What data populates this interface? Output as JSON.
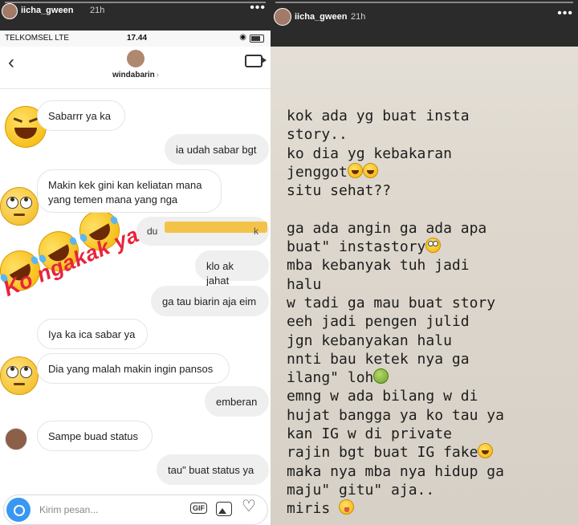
{
  "left_story": {
    "username": "iicha_gween",
    "time": "21h",
    "more": "•••"
  },
  "right_story": {
    "username": "iicha_gween",
    "time": "21h",
    "more": "•••"
  },
  "phone": {
    "carrier": "TELKOMSEL  LTE",
    "clock": "17.44",
    "loc_icon": "◉",
    "back_icon": "‹",
    "contact_name": "windabarin",
    "contact_arrow": "›",
    "messages": [
      {
        "text": "Sabarrr ya ka",
        "side": "them"
      },
      {
        "text": "ia udah sabar bgt",
        "side": "me"
      },
      {
        "text": "Makin kek gini kan keliatan mana yang temen mana yang nga",
        "side": "them"
      },
      {
        "text": "klo ak jahat",
        "side": "me"
      },
      {
        "text": "ga tau biarin aja eim",
        "side": "me"
      },
      {
        "text": "Iya ka ica sabar ya",
        "side": "them"
      },
      {
        "text": "Dia yang malah makin ingin pansos",
        "side": "them"
      },
      {
        "text": "emberan",
        "side": "me"
      },
      {
        "text": "Sampe buad status",
        "side": "them"
      },
      {
        "text": "tau\" buat status ya",
        "side": "me"
      }
    ],
    "redacted_prefix": "du",
    "redacted_suffix": "k",
    "overlay_text": "Ko ngakak ya",
    "composer_placeholder": "Kirim pesan...",
    "gif_label": "GIF",
    "heart_icon": "♡"
  },
  "story_lines": [
    {
      "text": "kok ada yg buat insta"
    },
    {
      "text": "story.."
    },
    {
      "text": "ko dia yg kebakaran"
    },
    {
      "text": "jenggot",
      "emoji": [
        "rolling-laughing-icon",
        "rolling-laughing-icon"
      ]
    },
    {
      "text": "situ sehat??"
    },
    {
      "text": ""
    },
    {
      "text": "ga ada angin ga ada apa"
    },
    {
      "text": "buat\" instastory",
      "emoji": [
        "eye-roll-icon"
      ]
    },
    {
      "text": "mba kebanyak tuh jadi"
    },
    {
      "text": "halu"
    },
    {
      "text": "w tadi ga mau buat story"
    },
    {
      "text": "eeh jadi pengen julid"
    },
    {
      "text": "jgn kebanyakan halu"
    },
    {
      "text": "nnti bau ketek nya ga"
    },
    {
      "text": "ilang\" loh",
      "emoji": [
        "nauseated-icon"
      ]
    },
    {
      "text": "emng w ada bilang w di"
    },
    {
      "text": "hujat bangga ya ko tau ya"
    },
    {
      "text": "kan IG w di private"
    },
    {
      "text": "rajin bgt buat IG fake",
      "emoji": [
        "rolling-laughing-icon"
      ]
    },
    {
      "text": "maka nya mba nya hidup ga"
    },
    {
      "text": "maju\" gitu\" aja.."
    },
    {
      "text": "miris ",
      "emoji": [
        "zany-face-icon"
      ]
    }
  ]
}
